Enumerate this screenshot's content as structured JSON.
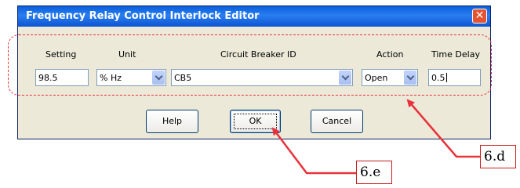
{
  "dialog": {
    "title": "Frequency Relay Control Interlock Editor",
    "close_symbol": "✕"
  },
  "columns": {
    "setting": "Setting",
    "unit": "Unit",
    "breaker": "Circuit Breaker ID",
    "action": "Action",
    "delay": "Time Delay"
  },
  "fields": {
    "setting_value": "98.5",
    "unit_value": "% Hz",
    "breaker_value": "CB5",
    "action_value": "Open",
    "delay_value": "0.5"
  },
  "buttons": {
    "help": "Help",
    "ok": "OK",
    "cancel": "Cancel"
  },
  "callouts": {
    "d": "6.d",
    "e": "6.e"
  },
  "colors": {
    "annotation_red": "#e8323c",
    "titlebar_blue": "#0a5fdc"
  }
}
